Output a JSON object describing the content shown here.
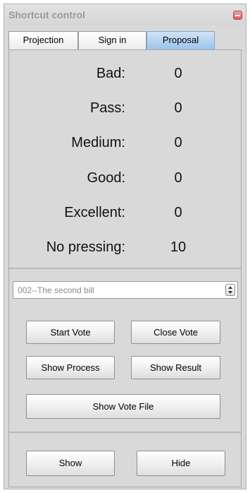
{
  "window": {
    "title": "Shortcut control",
    "close_icon": "close-icon"
  },
  "tabs": [
    {
      "label": "Projection",
      "active": false
    },
    {
      "label": "Sign in",
      "active": false
    },
    {
      "label": "Proposal",
      "active": true
    }
  ],
  "stats": [
    {
      "label": "Bad:",
      "value": "0"
    },
    {
      "label": "Pass:",
      "value": "0"
    },
    {
      "label": "Medium:",
      "value": "0"
    },
    {
      "label": "Good:",
      "value": "0"
    },
    {
      "label": "Excellent:",
      "value": "0"
    },
    {
      "label": "No pressing:",
      "value": "10"
    }
  ],
  "bill_select": {
    "selected": "002--The second bill",
    "icon": "updown-arrows-icon"
  },
  "buttons": {
    "start_vote": "Start Vote",
    "close_vote": "Close Vote",
    "show_process": "Show Process",
    "show_result": "Show Result",
    "show_vote_file": "Show Vote File",
    "show": "Show",
    "hide": "Hide"
  },
  "colors": {
    "active_tab": "#9cc4ea",
    "close_button": "#e05a5a",
    "panel_bg": "#d9d9d9"
  }
}
